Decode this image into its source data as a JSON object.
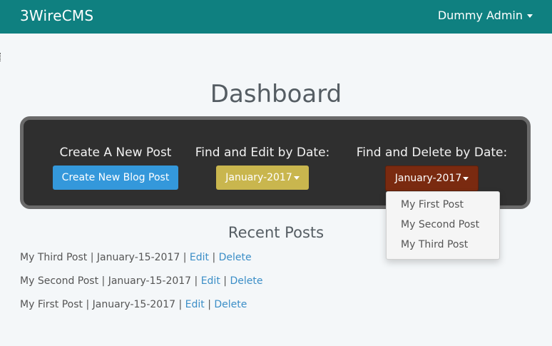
{
  "navbar": {
    "brand": "3WireCMS",
    "user_label": "Dummy Admin",
    "bg_color": "#0f8080"
  },
  "page": {
    "title": "Dashboard"
  },
  "panel": {
    "create": {
      "label": "Create A New Post",
      "button": "Create New Blog Post"
    },
    "edit": {
      "label": "Find and Edit by Date:",
      "button": "January-2017"
    },
    "delete": {
      "label": "Find and Delete by Date:",
      "button": "January-2017"
    }
  },
  "delete_dropdown": {
    "items": [
      "My First Post",
      "My Second Post",
      "My Third Post"
    ]
  },
  "recent": {
    "title": "Recent Posts",
    "posts": [
      {
        "text": "My Third Post | January-15-2017 | ",
        "edit": "Edit",
        "sep": " | ",
        "delete": "Delete"
      },
      {
        "text": "My Second Post | January-15-2017 | ",
        "edit": "Edit",
        "sep": " | ",
        "delete": "Delete"
      },
      {
        "text": "My First Post | January-15-2017 | ",
        "edit": "Edit",
        "sep": " | ",
        "delete": "Delete"
      }
    ]
  },
  "icons": {
    "user_menu": "caret-down-icon",
    "date_dropdown": "caret-down-icon"
  }
}
